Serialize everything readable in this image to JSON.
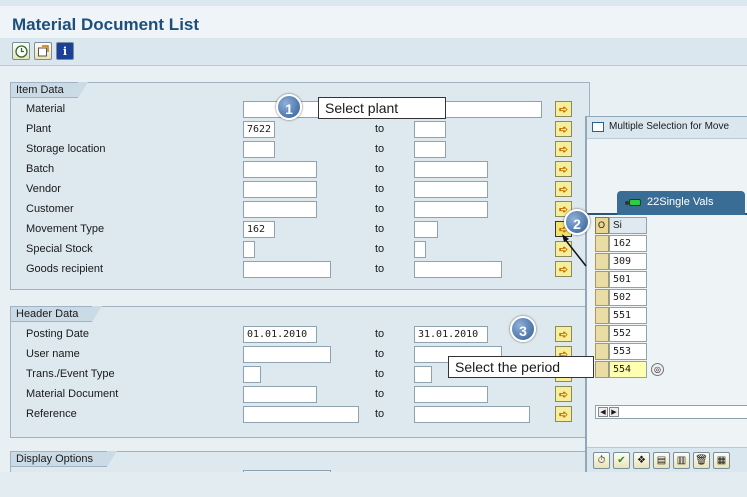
{
  "window": {
    "title": "Material Document List"
  },
  "toolbar": {
    "execute_icon": "clock-execute-icon",
    "variant_icon": "get-variant-icon",
    "info_icon": "info-icon",
    "info_glyph": "i"
  },
  "item_data": {
    "tab": "Item Data",
    "rows": [
      {
        "label": "Material",
        "from": "",
        "to_label": "",
        "to": ""
      },
      {
        "label": "Plant",
        "from": "7622",
        "to_label": "to",
        "to": ""
      },
      {
        "label": "Storage location",
        "from": "",
        "to_label": "to",
        "to": ""
      },
      {
        "label": "Batch",
        "from": "",
        "to_label": "to",
        "to": ""
      },
      {
        "label": "Vendor",
        "from": "",
        "to_label": "to",
        "to": ""
      },
      {
        "label": "Customer",
        "from": "",
        "to_label": "to",
        "to": ""
      },
      {
        "label": "Movement Type",
        "from": "162",
        "to_label": "to",
        "to": ""
      },
      {
        "label": "Special Stock",
        "from": "",
        "to_label": "to",
        "to": ""
      },
      {
        "label": "Goods recipient",
        "from": "",
        "to_label": "to",
        "to": ""
      }
    ]
  },
  "header_data": {
    "tab": "Header Data",
    "rows": [
      {
        "label": "Posting Date",
        "from": "01.01.2010",
        "to_label": "to",
        "to": "31.01.2010"
      },
      {
        "label": "User name",
        "from": "",
        "to_label": "to",
        "to": ""
      },
      {
        "label": "Trans./Event Type",
        "from": "",
        "to_label": "to",
        "to": ""
      },
      {
        "label": "Material Document",
        "from": "",
        "to_label": "to",
        "to": ""
      },
      {
        "label": "Reference",
        "from": "",
        "to_label": "to",
        "to": ""
      }
    ]
  },
  "display_options": {
    "tab": "Display Options"
  },
  "callouts": [
    {
      "number": "1",
      "text": "Select plant"
    },
    {
      "number": "2",
      "text": ""
    },
    {
      "number": "3",
      "text": "Select the period"
    }
  ],
  "popup": {
    "title": "Multiple Selection for Move",
    "tab_label": "22Single Vals",
    "grid_header": {
      "c1": "O",
      "c2": "Si"
    },
    "values": [
      "162",
      "309",
      "501",
      "502",
      "551",
      "552",
      "553",
      "554"
    ]
  },
  "colors": {
    "title": "#1d4f7a",
    "tab_active": "#3a6d95",
    "callout": "#2f5b94"
  }
}
